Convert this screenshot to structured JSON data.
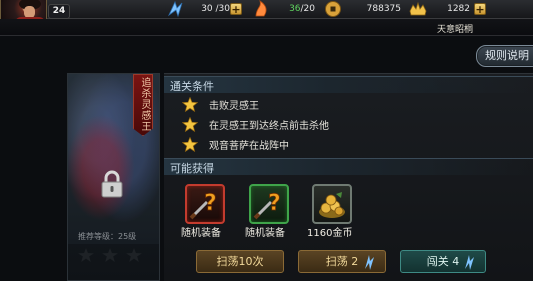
{
  "header": {
    "level": "24",
    "stamina": "30 /30",
    "energy": "36",
    "energy_max": "/20",
    "coins": "788375",
    "ingots": "1282",
    "server_name": "天意昭桐",
    "rules_button": "规则说明",
    "colors": {
      "energy_value": "#5fd35f",
      "gold": "#e7b94a"
    }
  },
  "stage": {
    "title": "追杀灵感王",
    "recommend_level": "推荐等级：25级",
    "locked": true
  },
  "conditions": {
    "heading": "通关条件",
    "items": [
      "击败灵感王",
      "在灵感王到达终点前击杀他",
      "观音菩萨在战阵中"
    ]
  },
  "rewards": {
    "heading": "可能获得",
    "items": [
      {
        "label": "随机装备",
        "icon": "random-equipment-red-icon"
      },
      {
        "label": "随机装备",
        "icon": "random-equipment-green-icon"
      },
      {
        "label": "1160金币",
        "icon": "gold-coin-pile-icon"
      }
    ]
  },
  "actions": {
    "sweep_ten": "扫荡10次",
    "sweep_one": "扫荡",
    "sweep_one_cost": "2",
    "challenge": "闯关",
    "challenge_cost": "4"
  }
}
